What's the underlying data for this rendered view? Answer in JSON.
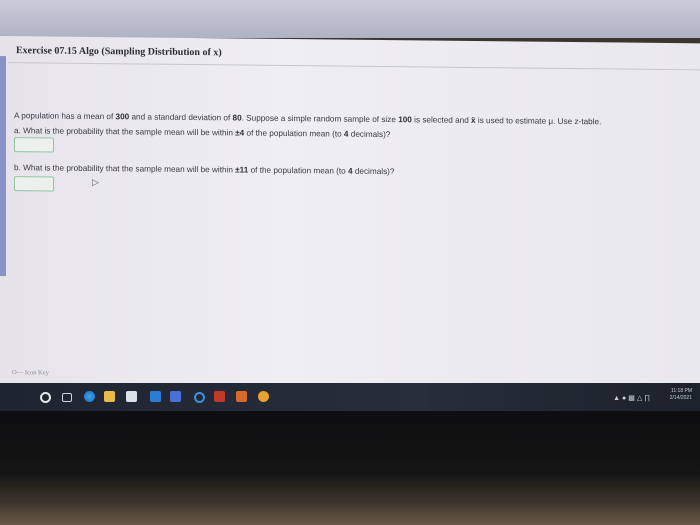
{
  "exercise": {
    "title": "Exercise 07.15 Algo (Sampling Distribution of x)"
  },
  "question": {
    "intro_pre": "A population has a mean of ",
    "mean": "300",
    "intro_mid1": " and a standard deviation of ",
    "sd": "80",
    "intro_mid2": ". Suppose a simple random sample of size ",
    "n": "100",
    "intro_mid3": " is selected and ",
    "xbar": "x̄",
    "intro_end": " is used to estimate μ. Use z-table.",
    "part_a_pre": "a. What is the probability that the sample mean will be within ",
    "part_a_val": "±4",
    "part_a_post": " of the population mean (to ",
    "part_a_dec": "4",
    "part_a_end": " decimals)?",
    "part_b_pre": "b. What is the probability that the sample mean will be within ",
    "part_b_val": "±11",
    "part_b_post": " of the population mean (to ",
    "part_b_dec": "4",
    "part_b_end": " decimals)?"
  },
  "answers": {
    "a_value": "",
    "b_value": ""
  },
  "footer": {
    "icon_key": "Icon Key"
  },
  "taskbar": {
    "time": "11:18 PM",
    "date": "2/14/2021",
    "accent": "#1e2430"
  }
}
